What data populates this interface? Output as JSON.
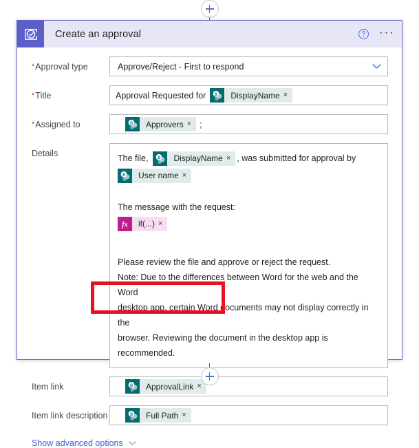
{
  "connectors": {
    "top": {
      "add_icon": "plus-icon",
      "arrow_icon": "arrow-down-icon"
    },
    "bottom": {
      "add_icon": "plus-icon"
    }
  },
  "card": {
    "icon": "approval-icon",
    "title": "Create an approval",
    "help_icon": "help-circle-icon",
    "more_icon": "ellipsis-icon",
    "more_label": "···",
    "header_bg": "#e6e6f7",
    "icon_bg": "#5b5fc7",
    "border_color": "#6264c7"
  },
  "fields": {
    "approval_type": {
      "label": "Approval type",
      "required": true,
      "value": "Approve/Reject - First to respond",
      "chevron_icon": "chevron-down-icon"
    },
    "title": {
      "label": "Title",
      "required": true,
      "prefix_text": "Approval Requested for",
      "token": {
        "label": "DisplayName",
        "icon": "sharepoint-icon",
        "remove": "×"
      }
    },
    "assigned_to": {
      "label": "Assigned to",
      "required": true,
      "token": {
        "label": "Approvers",
        "icon": "sharepoint-icon",
        "remove": "×"
      },
      "separator": ";"
    },
    "details": {
      "label": "Details",
      "required": false,
      "line1_prefix": "The file,",
      "line1_token": {
        "label": "DisplayName",
        "icon": "sharepoint-icon",
        "remove": "×"
      },
      "line1_suffix": ", was submitted for approval by",
      "line2_token": {
        "label": "User name",
        "icon": "sharepoint-icon",
        "remove": "×"
      },
      "line3_text": "The message with the request:",
      "line4_token": {
        "label": "if(...)",
        "icon": "expression-fx-icon",
        "remove": "×"
      },
      "para1": "Please review the file and approve or reject the request.",
      "para2": "Note: Due to the differences between Word for the web and the Word",
      "para3": "desktop app, certain Word documents may not display correctly in the",
      "para4": "browser. Reviewing the document in the desktop app is recommended."
    },
    "item_link": {
      "label": "Item link",
      "required": false,
      "token": {
        "label": "ApprovalLink",
        "icon": "sharepoint-icon",
        "remove": "×"
      },
      "highlighted": true
    },
    "item_link_description": {
      "label": "Item link description",
      "required": false,
      "token": {
        "label": "Full Path",
        "icon": "sharepoint-icon",
        "remove": "×"
      }
    }
  },
  "advanced": {
    "label": "Show advanced options",
    "chevron_icon": "chevron-down-icon"
  },
  "annotation": {
    "color": "#e81123",
    "target": "item-link-field"
  },
  "colors": {
    "accent": "#5b5fc7",
    "sharepoint_teal": "#036c70",
    "chip_bg": "#dfeceb",
    "expression_magenta": "#bf1e8e",
    "expression_chip_bg": "#f6ddf2",
    "required_star": "#c4314b",
    "link_blue": "#3a63d6"
  }
}
